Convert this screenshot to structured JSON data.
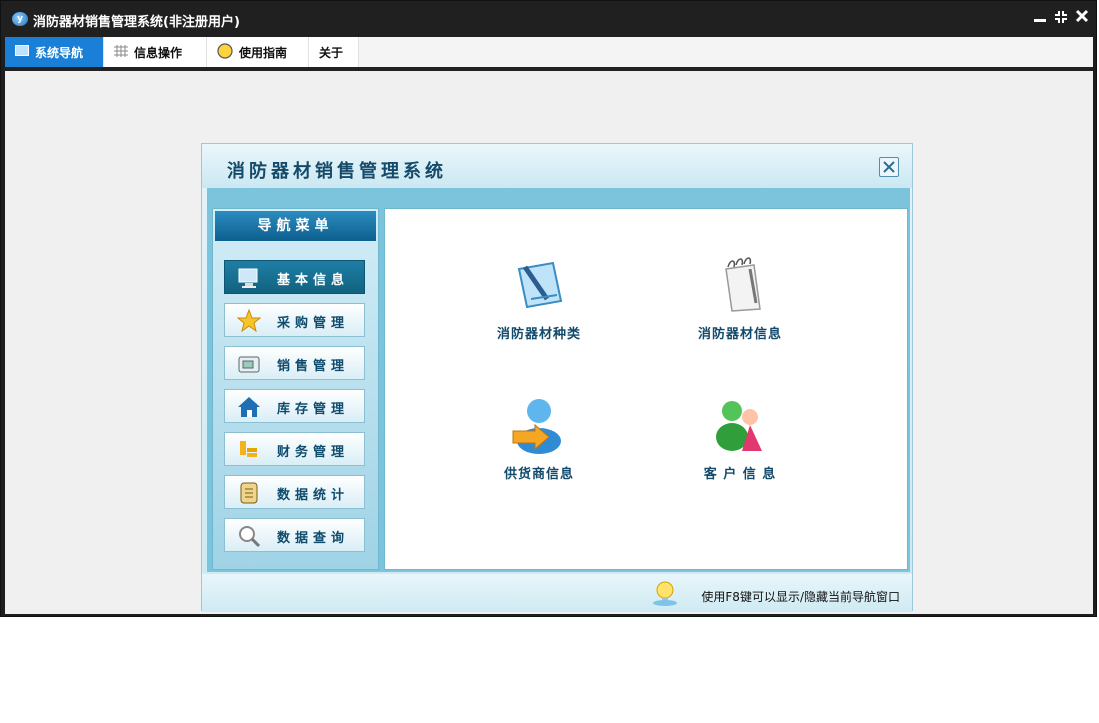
{
  "window": {
    "title": "消防器材销售管理系统(非注册用户)",
    "logo_letter": "y",
    "controls": [
      "minimize-icon",
      "restore-icon",
      "close-icon"
    ]
  },
  "menu": {
    "tabs": [
      {
        "label": "系统导航",
        "icon": "monitor-icon",
        "active": true
      },
      {
        "label": "信息操作",
        "icon": "grid-icon",
        "active": false
      },
      {
        "label": "使用指南",
        "icon": "help-circle-icon",
        "active": false
      },
      {
        "label": "关于",
        "icon": "",
        "active": false
      }
    ]
  },
  "dialog": {
    "title": "消防器材销售管理系统",
    "nav_header": "导航菜单",
    "nav_items": [
      {
        "label": "基本信息",
        "icon": "computer-icon",
        "active": true
      },
      {
        "label": "采购管理",
        "icon": "star-icon",
        "active": false
      },
      {
        "label": "销售管理",
        "icon": "card-icon",
        "active": false
      },
      {
        "label": "库存管理",
        "icon": "home-icon",
        "active": false
      },
      {
        "label": "财务管理",
        "icon": "coins-icon",
        "active": false
      },
      {
        "label": "数据统计",
        "icon": "scroll-icon",
        "active": false
      },
      {
        "label": "数据查询",
        "icon": "magnifier-icon",
        "active": false
      }
    ],
    "items": [
      {
        "label": "消防器材种类",
        "icon": "document-pen-icon"
      },
      {
        "label": "消防器材信息",
        "icon": "notepad-icon"
      },
      {
        "label": "供货商信息",
        "icon": "user-arrow-icon"
      },
      {
        "label": "客 户 信 息",
        "icon": "people-icon"
      }
    ],
    "footer_hint": "使用F8键可以显示/隐藏当前导航窗口",
    "accent_color": "#1a7fd6"
  }
}
